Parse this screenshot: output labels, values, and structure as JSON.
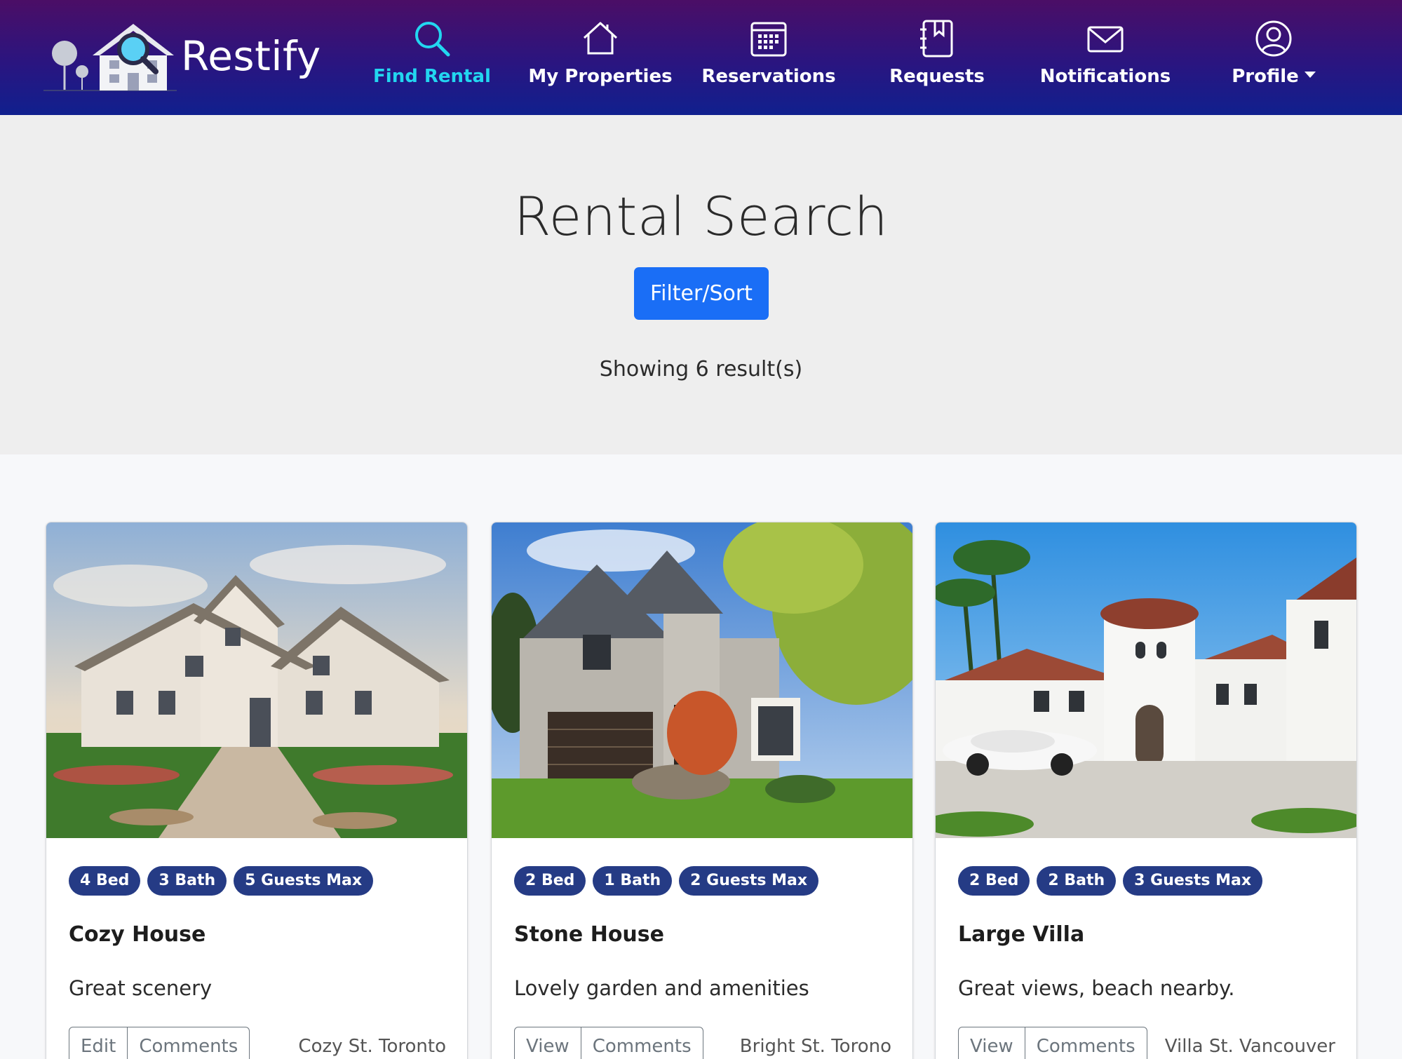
{
  "brand": {
    "name": "Restify",
    "logo_icon": "house-magnifier-icon"
  },
  "nav": {
    "items": [
      {
        "label": "Find Rental",
        "icon": "search-icon",
        "active": true
      },
      {
        "label": "My Properties",
        "icon": "house-icon",
        "active": false
      },
      {
        "label": "Reservations",
        "icon": "calendar-icon",
        "active": false
      },
      {
        "label": "Requests",
        "icon": "journal-bookmark-icon",
        "active": false
      },
      {
        "label": "Notifications",
        "icon": "envelope-icon",
        "active": false
      },
      {
        "label": "Profile",
        "icon": "person-circle-icon",
        "active": false,
        "dropdown": true
      }
    ]
  },
  "hero": {
    "title": "Rental Search",
    "filter_button": "Filter/Sort",
    "results_text": "Showing 6 result(s)"
  },
  "cards": [
    {
      "badges": [
        "4 Bed",
        "3 Bath",
        "5 Guests Max"
      ],
      "title": "Cozy House",
      "description": "Great scenery",
      "buttons": [
        "Edit",
        "Comments"
      ],
      "address": "Cozy St. Toronto",
      "image": "suburban-house-photo"
    },
    {
      "badges": [
        "2 Bed",
        "1 Bath",
        "2 Guests Max"
      ],
      "title": "Stone House",
      "description": "Lovely garden and amenities",
      "buttons": [
        "View",
        "Comments"
      ],
      "address": "Bright St. Torono",
      "image": "stone-house-photo"
    },
    {
      "badges": [
        "2 Bed",
        "2 Bath",
        "3 Guests Max"
      ],
      "title": "Large Villa",
      "description": "Great views, beach nearby.",
      "buttons": [
        "View",
        "Comments"
      ],
      "address": "Villa St. Vancouver",
      "image": "mediterranean-villa-photo"
    }
  ],
  "colors": {
    "nav_top": "#4b0e66",
    "nav_bottom": "#10208e",
    "active": "#22d6f0",
    "primary_button": "#1a6ef6",
    "badge": "#253b85"
  }
}
